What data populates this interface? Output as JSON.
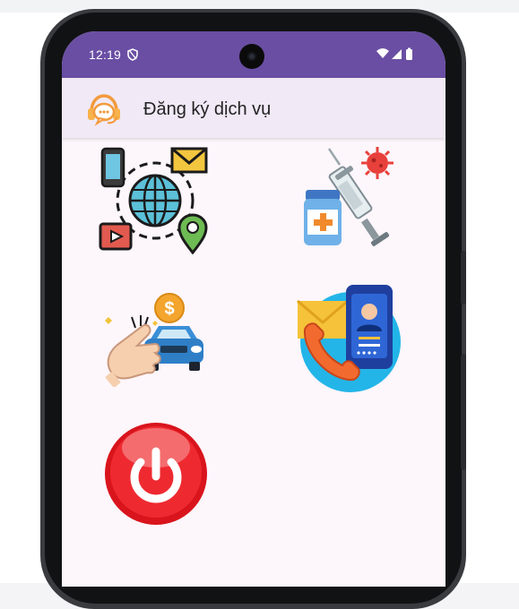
{
  "status_bar": {
    "time": "12:19"
  },
  "app_bar": {
    "title": "Đăng ký dịch vụ"
  },
  "menu_tiles": [
    {
      "icon": "network-services-icon"
    },
    {
      "icon": "vaccine-medicine-icon"
    },
    {
      "icon": "car-booking-payment-icon"
    },
    {
      "icon": "contact-phone-icon"
    },
    {
      "icon": "power-exit-icon"
    }
  ],
  "colors": {
    "status_bar": "#6a4ea3",
    "app_bar": "#f1e9f6",
    "screen_bg": "#fdf6fb",
    "power_red": "#e32028"
  }
}
